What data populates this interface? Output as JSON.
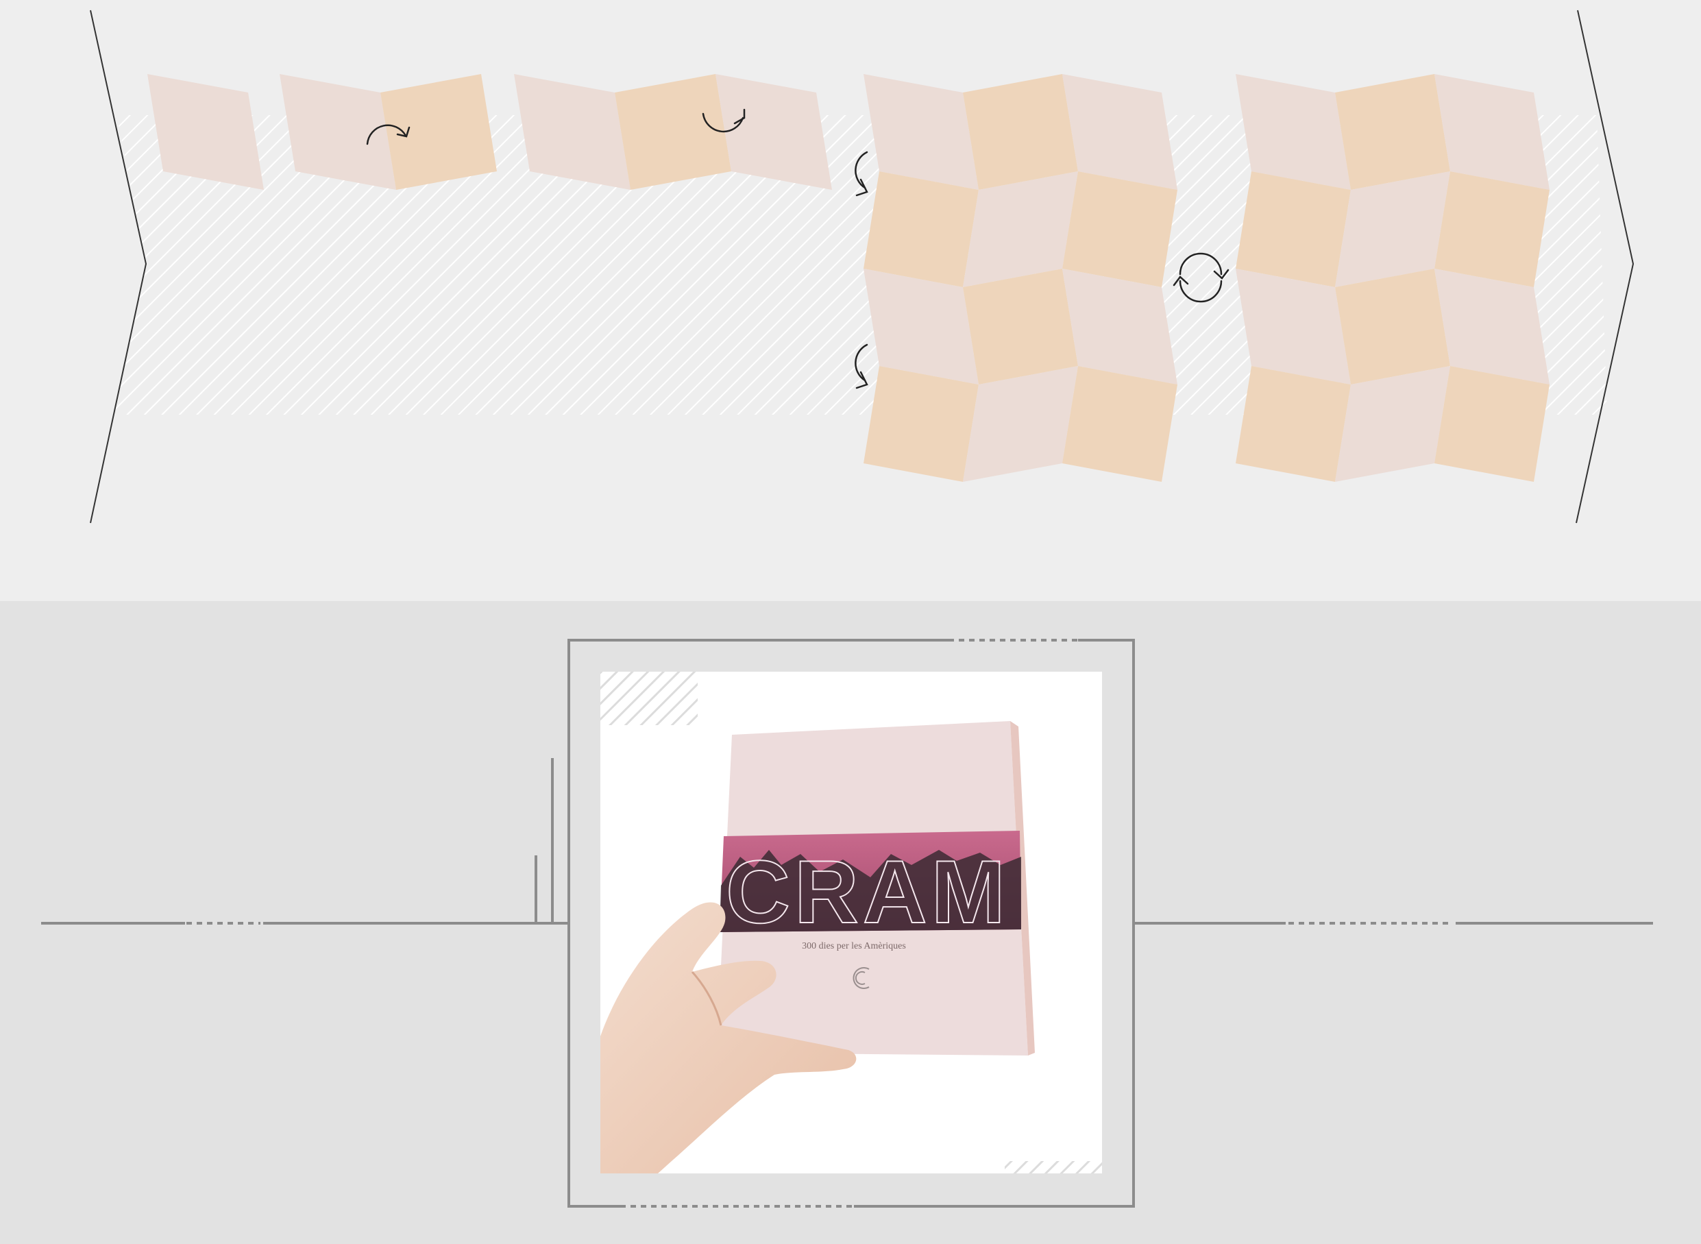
{
  "colors": {
    "top_background": "#eeeeee",
    "bottom_background": "#e2e2e2",
    "panel_light": "#ebdcd6",
    "panel_dark": "#eed5bb",
    "hatch": "#ffffff",
    "line": "#7a7a7a",
    "frame": "#8c8c8c",
    "band": "#c4587c",
    "band_dark": "#3b2a33"
  },
  "icons": {
    "rotate_arrow": "curved-arrow-icon",
    "cycle_arrows": "cycle-icon",
    "logo": "c-logo-icon"
  },
  "book": {
    "title": "CRAM",
    "subtitle": "300 dies per les Amèriques"
  }
}
